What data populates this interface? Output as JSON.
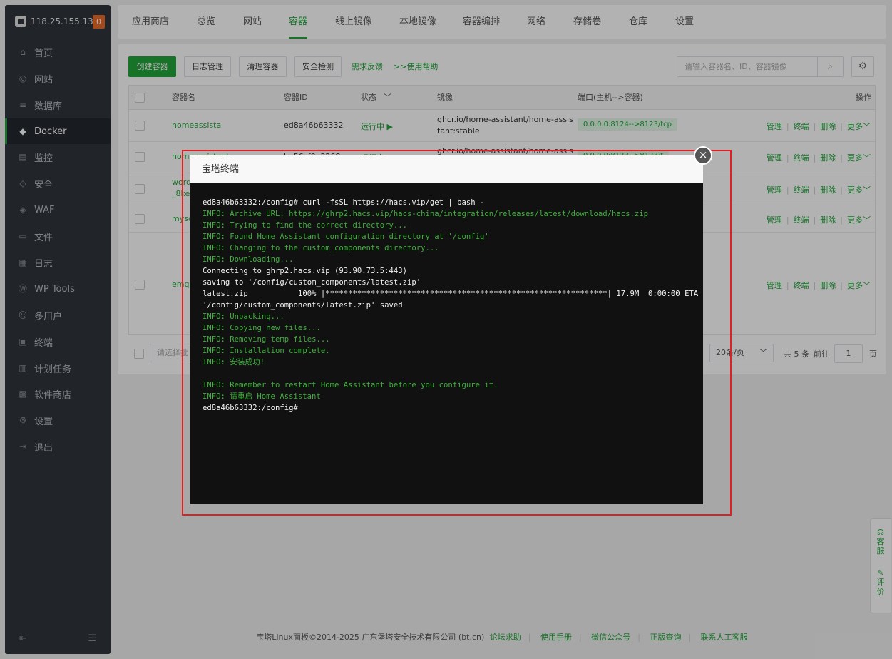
{
  "sidebar": {
    "host": "118.25.155.139",
    "badge": "0",
    "items": [
      {
        "label": "首页",
        "icon": "home-icon"
      },
      {
        "label": "网站",
        "icon": "globe-icon"
      },
      {
        "label": "数据库",
        "icon": "database-icon"
      },
      {
        "label": "Docker",
        "icon": "docker-icon"
      },
      {
        "label": "监控",
        "icon": "monitor-icon"
      },
      {
        "label": "安全",
        "icon": "shield-icon"
      },
      {
        "label": "WAF",
        "icon": "waf-icon"
      },
      {
        "label": "文件",
        "icon": "folder-icon"
      },
      {
        "label": "日志",
        "icon": "log-icon"
      },
      {
        "label": "WP Tools",
        "icon": "wordpress-icon"
      },
      {
        "label": "多用户",
        "icon": "users-icon"
      },
      {
        "label": "终端",
        "icon": "terminal-icon"
      },
      {
        "label": "计划任务",
        "icon": "calendar-icon"
      },
      {
        "label": "软件商店",
        "icon": "store-icon"
      },
      {
        "label": "设置",
        "icon": "gear-icon"
      },
      {
        "label": "退出",
        "icon": "logout-icon"
      }
    ],
    "active": "Docker"
  },
  "tabs": [
    "应用商店",
    "总览",
    "网站",
    "容器",
    "线上镜像",
    "本地镜像",
    "容器编排",
    "网络",
    "存储卷",
    "仓库",
    "设置"
  ],
  "active_tab": "容器",
  "toolbar": {
    "create": "创建容器",
    "logs": "日志管理",
    "clean": "清理容器",
    "security": "安全检测",
    "feedback": "需求反馈",
    "help": ">>使用帮助",
    "search_placeholder": "请输入容器名、ID、容器镜像"
  },
  "table": {
    "headers": {
      "name": "容器名",
      "id": "容器ID",
      "status": "状态",
      "image": "镜像",
      "port": "端口(主机-->容器)",
      "ops": "操作"
    },
    "rows": [
      {
        "name": "homeassista",
        "id": "ed8a46b63332",
        "status": "运行中",
        "image1": "ghcr.io/home-assistant/home-assis",
        "image2": "tant:stable",
        "port": "0.0.0.0:8124-->8123/tcp"
      },
      {
        "name": "homeassistant",
        "id": "ba56cf0a3268",
        "status": "运行中",
        "image1": "ghcr.io/home-assistant/home-assis",
        "image2": "",
        "port": "0.0.0.0:8123-->8123/t"
      },
      {
        "name": "word",
        "name2": "_8ke",
        "id": "",
        "status": "",
        "image1": "",
        "image2": "",
        "port": ""
      },
      {
        "name": "myso",
        "id": "",
        "status": "",
        "image1": "",
        "image2": "",
        "port": ""
      },
      {
        "name": "emqx",
        "id": "",
        "status": "",
        "image1": "",
        "image2": "",
        "port": ""
      }
    ],
    "ops": {
      "manage": "管理",
      "terminal": "终端",
      "delete": "删除",
      "more": "更多"
    }
  },
  "pager": {
    "select_placeholder": "请选择批",
    "per_page": "20条/页",
    "total": "共 5 条",
    "goto": "前往",
    "page": "1",
    "page_unit": "页"
  },
  "footer": {
    "copyright": "宝塔Linux面板©2014-2025 广东堡塔安全技术有限公司 (bt.cn)",
    "links": [
      "论坛求助",
      "使用手册",
      "微信公众号",
      "正版查询",
      "联系人工客服"
    ]
  },
  "helper": {
    "service": "客服",
    "review": "评价"
  },
  "modal": {
    "title": "宝塔终端",
    "close": "×",
    "lines": [
      {
        "t": "ed8a46b63332:/config# curl -fsSL https://hacs.vip/get | bash -",
        "c": "w"
      },
      {
        "t": "INFO: Archive URL: https://ghrp2.hacs.vip/hacs-china/integration/releases/latest/download/hacs.zip",
        "c": "g"
      },
      {
        "t": "INFO: Trying to find the correct directory...",
        "c": "g"
      },
      {
        "t": "INFO: Found Home Assistant configuration directory at '/config'",
        "c": "g"
      },
      {
        "t": "INFO: Changing to the custom_components directory...",
        "c": "g"
      },
      {
        "t": "INFO: Downloading...",
        "c": "g"
      },
      {
        "t": "Connecting to ghrp2.hacs.vip (93.90.73.5:443)",
        "c": "w"
      },
      {
        "t": "saving to '/config/custom_components/latest.zip'",
        "c": "w"
      },
      {
        "t": "latest.zip           100% |**************************************************************| 17.9M  0:00:00 ETA",
        "c": "w"
      },
      {
        "t": "'/config/custom_components/latest.zip' saved",
        "c": "w"
      },
      {
        "t": "INFO: Unpacking...",
        "c": "g"
      },
      {
        "t": "INFO: Copying new files...",
        "c": "g"
      },
      {
        "t": "INFO: Removing temp files...",
        "c": "g"
      },
      {
        "t": "INFO: Installation complete.",
        "c": "g"
      },
      {
        "t": "INFO: 安装成功!",
        "c": "g"
      },
      {
        "t": "",
        "c": "w"
      },
      {
        "t": "INFO: Remember to restart Home Assistant before you configure it.",
        "c": "g"
      },
      {
        "t": "INFO: 请重启 Home Assistant",
        "c": "g"
      },
      {
        "t": "ed8a46b63332:/config#",
        "c": "w"
      }
    ]
  }
}
